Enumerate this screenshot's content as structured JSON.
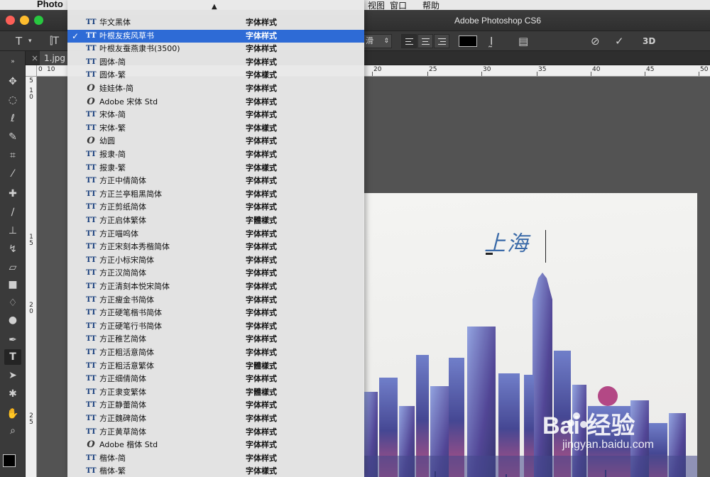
{
  "menubar": {
    "apple": "",
    "app": "Photo",
    "items": [
      "视图",
      "窗口",
      "帮助"
    ]
  },
  "titlebar": {
    "title": "Adobe Photoshop CS6"
  },
  "options_bar": {
    "antialias": "滑",
    "color_value": "#000000",
    "three_d_label": "3D"
  },
  "document": {
    "tab_label": "1.jpg",
    "ruler_top": [
      "10",
      "20",
      "25",
      "30",
      "35",
      "40",
      "45",
      "50"
    ],
    "ruler_top_left": "0",
    "ruler_left": [
      "1\n0",
      "1\n5",
      "2\n0",
      "2\n5"
    ],
    "ruler_left_top": "5",
    "canvas_text": "上海",
    "watermark": "Bai 经验",
    "watermark_sub": "jingyan.baidu.com"
  },
  "font_menu": {
    "selected_index": 1,
    "fonts": [
      {
        "name": "华文黑体",
        "sample": "字体样式",
        "icon": "TT"
      },
      {
        "name": "叶根友疾风草书",
        "sample": "字体样式",
        "icon": "TT"
      },
      {
        "name": "叶根友蚕燕隶书(3500)",
        "sample": "字体样式",
        "icon": "TT"
      },
      {
        "name": "圆体-简",
        "sample": "字体样式",
        "icon": "TT"
      },
      {
        "name": "圆体-繁",
        "sample": "字体樣式",
        "icon": "TT"
      },
      {
        "name": "娃娃体-简",
        "sample": "字体样式",
        "icon": "O"
      },
      {
        "name": "Adobe 宋体 Std",
        "sample": "字体样式",
        "icon": "O"
      },
      {
        "name": "宋体-简",
        "sample": "字体样式",
        "icon": "TT"
      },
      {
        "name": "宋体-繁",
        "sample": "字体樣式",
        "icon": "TT"
      },
      {
        "name": "幼圆",
        "sample": "字体样式",
        "icon": "O"
      },
      {
        "name": "报隶-简",
        "sample": "字体样式",
        "icon": "TT"
      },
      {
        "name": "报隶-繁",
        "sample": "字体樣式",
        "icon": "TT"
      },
      {
        "name": "方正中倩简体",
        "sample": "字体样式",
        "icon": "TT"
      },
      {
        "name": "方正兰亭粗黑简体",
        "sample": "字体样式",
        "icon": "TT"
      },
      {
        "name": "方正剪纸简体",
        "sample": "字体样式",
        "icon": "TT"
      },
      {
        "name": "方正启体繁体",
        "sample": "字體樣式",
        "icon": "TT"
      },
      {
        "name": "方正喵呜体",
        "sample": "字体样式",
        "icon": "TT"
      },
      {
        "name": "方正宋刻本秀楷简体",
        "sample": "字体样式",
        "icon": "TT"
      },
      {
        "name": "方正小标宋简体",
        "sample": "字体样式",
        "icon": "TT"
      },
      {
        "name": "方正汉简简体",
        "sample": "字体样式",
        "icon": "TT"
      },
      {
        "name": "方正清刻本悦宋简体",
        "sample": "字体样式",
        "icon": "TT"
      },
      {
        "name": "方正瘦金书简体",
        "sample": "字体样式",
        "icon": "TT"
      },
      {
        "name": "方正硬笔楷书简体",
        "sample": "字体样式",
        "icon": "TT"
      },
      {
        "name": "方正硬笔行书简体",
        "sample": "字体样式",
        "icon": "TT"
      },
      {
        "name": "方正稚艺简体",
        "sample": "字体样式",
        "icon": "TT"
      },
      {
        "name": "方正粗活意简体",
        "sample": "字体样式",
        "icon": "TT"
      },
      {
        "name": "方正粗活意繁体",
        "sample": "字體樣式",
        "icon": "TT"
      },
      {
        "name": "方正细倩简体",
        "sample": "字体样式",
        "icon": "TT"
      },
      {
        "name": "方正隶变繁体",
        "sample": "字體樣式",
        "icon": "TT"
      },
      {
        "name": "方正静蕾简体",
        "sample": "字体样式",
        "icon": "TT"
      },
      {
        "name": "方正魏碑简体",
        "sample": "字体样式",
        "icon": "TT"
      },
      {
        "name": "方正黄草简体",
        "sample": "字体样式",
        "icon": "TT"
      },
      {
        "name": "Adobe 楷体 Std",
        "sample": "字体样式",
        "icon": "O"
      },
      {
        "name": "楷体-简",
        "sample": "字体样式",
        "icon": "TT"
      },
      {
        "name": "楷体-繁",
        "sample": "字体樣式",
        "icon": "TT"
      }
    ]
  },
  "colors": {
    "selection": "#2e6bd6",
    "canvas_text": "#3a6aa8",
    "tl_close": "#fc5f57",
    "tl_min": "#fdbc2e",
    "tl_max": "#28c840"
  }
}
